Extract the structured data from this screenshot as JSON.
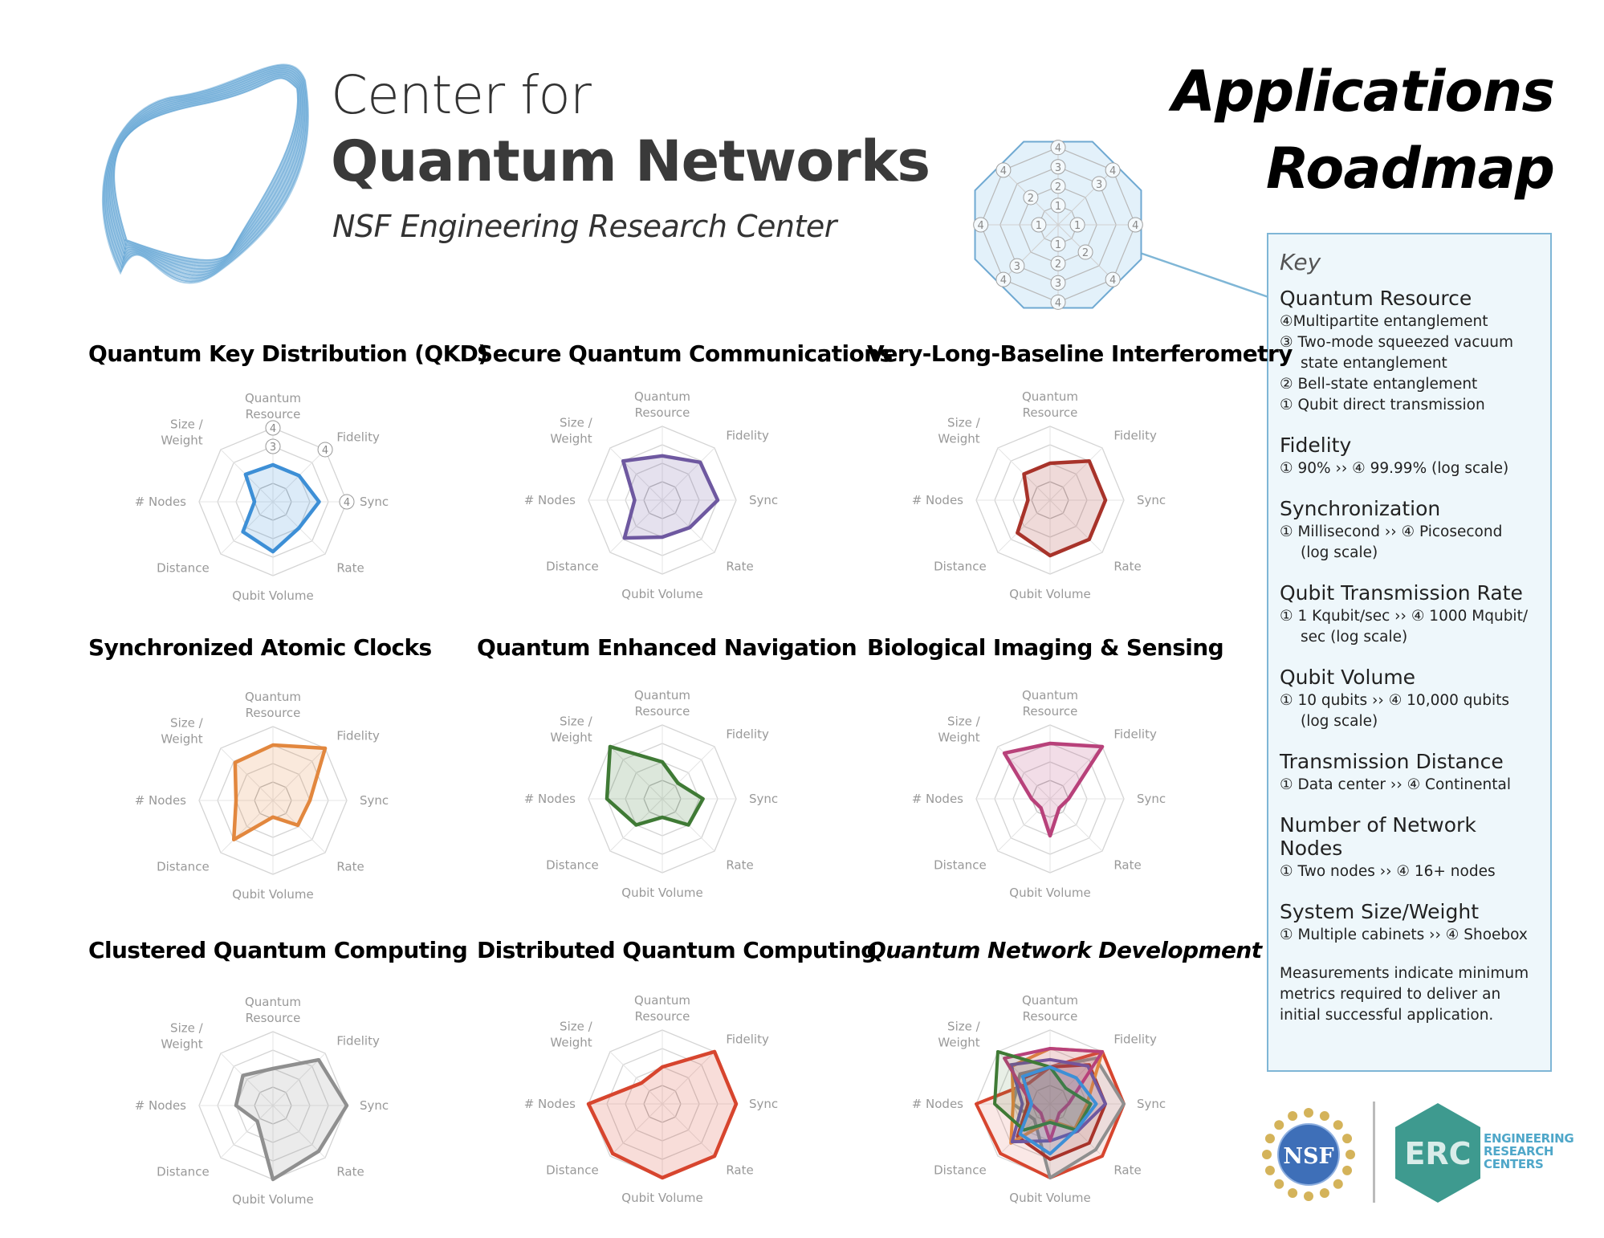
{
  "header": {
    "org_line1": "Center for",
    "org_line2": "Quantum Networks",
    "org_line3": "NSF Engineering Research Center",
    "title_line1": "Applications",
    "title_line2": "Roadmap"
  },
  "key_diagram": {
    "ring_labels": [
      "①",
      "②",
      "③",
      "④"
    ]
  },
  "key": {
    "title": "Key",
    "sections": [
      {
        "heading": "Quantum Resource",
        "lines": [
          {
            "text": "④Multipartite entanglement",
            "indent": false
          },
          {
            "text": "③ Two-mode squeezed vacuum",
            "indent": false
          },
          {
            "text": "state entanglement",
            "indent": true
          },
          {
            "text": "② Bell-state entanglement",
            "indent": false
          },
          {
            "text": "① Qubit direct transmission",
            "indent": false
          }
        ]
      },
      {
        "heading": "Fidelity",
        "lines": [
          {
            "text": "① 90% ›› ④ 99.99% (log scale)",
            "indent": false
          }
        ]
      },
      {
        "heading": "Synchronization",
        "lines": [
          {
            "text": "① Millisecond ›› ④ Picosecond",
            "indent": false
          },
          {
            "text": "(log scale)",
            "indent": true
          }
        ]
      },
      {
        "heading": "Qubit Transmission Rate",
        "lines": [
          {
            "text": "① 1 Kqubit/sec ›› ④ 1000 Mqubit/",
            "indent": false
          },
          {
            "text": "sec (log scale)",
            "indent": true
          }
        ]
      },
      {
        "heading": "Qubit Volume",
        "lines": [
          {
            "text": "① 10 qubits ›› ④ 10,000 qubits",
            "indent": false
          },
          {
            "text": "(log scale)",
            "indent": true
          }
        ]
      },
      {
        "heading": "Transmission Distance",
        "lines": [
          {
            "text": "① Data center ›› ④ Continental",
            "indent": false
          }
        ]
      },
      {
        "heading": "Number of Network Nodes",
        "lines": [
          {
            "text": "① Two nodes ›› ④ 16+ nodes",
            "indent": false
          }
        ]
      },
      {
        "heading": "System Size/Weight",
        "lines": [
          {
            "text": "① Multiple cabinets ›› ④ Shoebox",
            "indent": false
          }
        ]
      }
    ],
    "note": "Measurements indicate minimum metrics required to deliver an initial successful application."
  },
  "logos": {
    "nsf": "NSF",
    "erc": "ERC",
    "erc_text": [
      "ENGINEERING",
      "RESEARCH",
      "CENTERS"
    ]
  },
  "chart_data": [
    {
      "type": "radar",
      "title": "Quantum Key Distribution (QKD)",
      "axes": [
        "Quantum Resource",
        "Fidelity",
        "Sync",
        "Rate",
        "Qubit Volume",
        "Distance",
        "# Nodes",
        "Size / Weight"
      ],
      "rmax": 4,
      "ring_labels": [
        {
          "axis": "Quantum Resource",
          "values": [
            "③",
            "④"
          ]
        },
        {
          "axis": "Fidelity",
          "values": [
            "④"
          ]
        },
        {
          "axis": "Sync",
          "values": [
            "④"
          ]
        }
      ],
      "series": [
        {
          "name": "QKD",
          "color": "#3d8fd6",
          "values": [
            2.0,
            2.0,
            2.5,
            2.0,
            2.7,
            2.3,
            1.0,
            2.1
          ]
        }
      ]
    },
    {
      "type": "radar",
      "title": "Secure Quantum Communications",
      "axes": [
        "Quantum Resource",
        "Fidelity",
        "Sync",
        "Rate",
        "Qubit Volume",
        "Distance",
        "# Nodes",
        "Size / Weight"
      ],
      "rmax": 4,
      "series": [
        {
          "name": "Secure Quantum Communications",
          "color": "#6e58a0",
          "values": [
            2.4,
            2.9,
            3.0,
            2.1,
            2.0,
            2.9,
            1.5,
            3.0
          ]
        }
      ]
    },
    {
      "type": "radar",
      "title": "Very-Long-Baseline Interferometry",
      "axes": [
        "Quantum Resource",
        "Fidelity",
        "Sync",
        "Rate",
        "Qubit Volume",
        "Distance",
        "# Nodes",
        "Size / Weight"
      ],
      "rmax": 4,
      "series": [
        {
          "name": "Very-Long-Baseline Interferometry",
          "color": "#a8332a",
          "values": [
            2.0,
            3.0,
            3.0,
            3.0,
            3.0,
            2.5,
            1.2,
            2.0
          ]
        }
      ]
    },
    {
      "type": "radar",
      "title": "Synchronized Atomic Clocks",
      "axes": [
        "Quantum Resource",
        "Fidelity",
        "Sync",
        "Rate",
        "Qubit Volume",
        "Distance",
        "# Nodes",
        "Size / Weight"
      ],
      "rmax": 4,
      "series": [
        {
          "name": "Synchronized Atomic Clocks",
          "color": "#e2873e",
          "values": [
            3.0,
            4.0,
            2.0,
            1.9,
            0.9,
            3.0,
            2.0,
            2.9
          ]
        }
      ]
    },
    {
      "type": "radar",
      "title": "Quantum Enhanced Navigation",
      "axes": [
        "Quantum Resource",
        "Fidelity",
        "Sync",
        "Rate",
        "Qubit Volume",
        "Distance",
        "# Nodes",
        "Size / Weight"
      ],
      "rmax": 4,
      "series": [
        {
          "name": "Quantum Enhanced Navigation",
          "color": "#3f7a35",
          "values": [
            2.0,
            1.2,
            2.2,
            2.0,
            1.0,
            2.0,
            3.0,
            4.0
          ]
        }
      ]
    },
    {
      "type": "radar",
      "title": "Biological Imaging & Sensing",
      "axes": [
        "Quantum Resource",
        "Fidelity",
        "Sync",
        "Rate",
        "Qubit Volume",
        "Distance",
        "# Nodes",
        "Size / Weight"
      ],
      "rmax": 4,
      "series": [
        {
          "name": "Biological Imaging & Sensing",
          "color": "#b8417a",
          "values": [
            3.0,
            4.0,
            1.0,
            0.7,
            2.0,
            0.7,
            1.0,
            3.5
          ]
        }
      ]
    },
    {
      "type": "radar",
      "title": "Clustered Quantum Computing",
      "axes": [
        "Quantum Resource",
        "Fidelity",
        "Sync",
        "Rate",
        "Qubit Volume",
        "Distance",
        "# Nodes",
        "Size / Weight"
      ],
      "rmax": 4,
      "series": [
        {
          "name": "Clustered Quantum Computing",
          "color": "#8f8f8f",
          "values": [
            2.0,
            3.5,
            4.0,
            3.5,
            4.0,
            1.2,
            2.0,
            2.3
          ]
        }
      ]
    },
    {
      "type": "radar",
      "title": "Distributed Quantum Computing",
      "axes": [
        "Quantum Resource",
        "Fidelity",
        "Sync",
        "Rate",
        "Qubit Volume",
        "Distance",
        "# Nodes",
        "Size / Weight"
      ],
      "rmax": 4,
      "series": [
        {
          "name": "Distributed Quantum Computing",
          "color": "#d7452e",
          "values": [
            2.0,
            4.0,
            4.0,
            4.0,
            4.0,
            3.8,
            4.0,
            1.6
          ]
        }
      ]
    },
    {
      "type": "radar",
      "title": "Quantum Network Development",
      "title_italic": true,
      "axes": [
        "Quantum Resource",
        "Fidelity",
        "Sync",
        "Rate",
        "Qubit Volume",
        "Distance",
        "# Nodes",
        "Size / Weight"
      ],
      "rmax": 4,
      "overlay": true,
      "series": [
        {
          "name": "Distributed Quantum Computing",
          "color": "#d7452e",
          "values": [
            2.0,
            4.0,
            4.0,
            4.0,
            4.0,
            3.8,
            4.0,
            1.6
          ]
        },
        {
          "name": "Clustered Quantum Computing",
          "color": "#8f8f8f",
          "values": [
            2.0,
            3.5,
            4.0,
            3.5,
            4.0,
            1.2,
            2.0,
            2.3
          ]
        },
        {
          "name": "Very-Long-Baseline Interferometry",
          "color": "#a8332a",
          "values": [
            2.0,
            3.0,
            3.0,
            3.0,
            3.0,
            2.5,
            1.2,
            2.0
          ]
        },
        {
          "name": "Synchronized Atomic Clocks",
          "color": "#e2873e",
          "values": [
            3.0,
            4.0,
            2.0,
            1.9,
            0.9,
            3.0,
            2.0,
            2.9
          ]
        },
        {
          "name": "Secure Quantum Communications",
          "color": "#6e58a0",
          "values": [
            2.4,
            2.9,
            3.0,
            2.1,
            2.0,
            2.9,
            1.5,
            3.0
          ]
        },
        {
          "name": "Biological Imaging & Sensing",
          "color": "#b8417a",
          "values": [
            3.0,
            4.0,
            1.0,
            0.7,
            2.0,
            0.7,
            1.0,
            3.5
          ]
        },
        {
          "name": "Quantum Enhanced Navigation",
          "color": "#3f7a35",
          "values": [
            2.0,
            1.2,
            2.2,
            2.0,
            1.0,
            2.0,
            3.0,
            4.0
          ]
        },
        {
          "name": "QKD",
          "color": "#3d8fd6",
          "values": [
            2.0,
            2.0,
            2.5,
            2.0,
            2.7,
            2.3,
            1.0,
            2.1
          ]
        }
      ]
    }
  ]
}
